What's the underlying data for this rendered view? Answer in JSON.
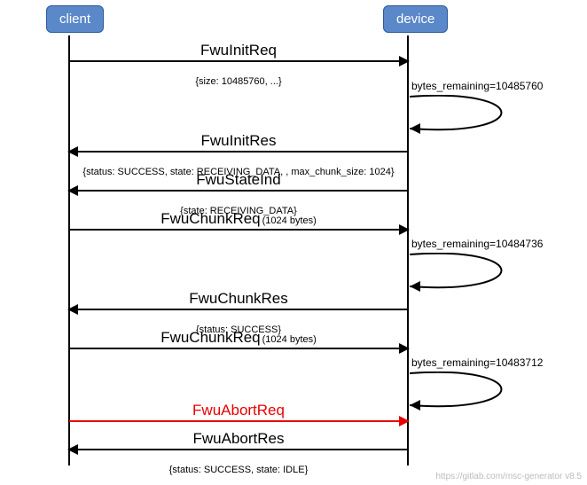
{
  "participants": {
    "client": "client",
    "device": "device"
  },
  "messages": {
    "m1": {
      "title": "FwuInitReq",
      "sub": "{size: 10485760, ...}"
    },
    "m2": {
      "title": "FwuInitRes",
      "sub": "{status: SUCCESS, state: RECEIVING_DATA, , max_chunk_size: 1024}"
    },
    "m3": {
      "title": "FwuStateInd",
      "sub": "{state: RECEIVING_DATA}"
    },
    "m4": {
      "title": "FwuChunkReq",
      "titleSuffix": "(1024 bytes)"
    },
    "m5": {
      "title": "FwuChunkRes",
      "sub": "{status: SUCCESS}"
    },
    "m6": {
      "title": "FwuChunkReq",
      "titleSuffix": "(1024 bytes)"
    },
    "m7": {
      "title": "FwuAbortReq"
    },
    "m8": {
      "title": "FwuAbortRes",
      "sub": "{status: SUCCESS, state: IDLE}"
    }
  },
  "selfMessages": {
    "s1": "bytes_remaining=10485760",
    "s2": "bytes_remaining=10484736",
    "s3": "bytes_remaining=10483712"
  },
  "credit": "https://gitlab.com/msc-generator v8.5",
  "chart_data": {
    "type": "sequence-diagram",
    "participants": [
      "client",
      "device"
    ],
    "events": [
      {
        "from": "client",
        "to": "device",
        "label": "FwuInitReq",
        "params": "{size: 10485760, ...}"
      },
      {
        "from": "device",
        "to": "device",
        "label": "bytes_remaining=10485760"
      },
      {
        "from": "device",
        "to": "client",
        "label": "FwuInitRes",
        "params": "{status: SUCCESS, state: RECEIVING_DATA, , max_chunk_size: 1024}"
      },
      {
        "from": "device",
        "to": "client",
        "label": "FwuStateInd",
        "params": "{state: RECEIVING_DATA}"
      },
      {
        "from": "client",
        "to": "device",
        "label": "FwuChunkReq",
        "params": "(1024 bytes)"
      },
      {
        "from": "device",
        "to": "device",
        "label": "bytes_remaining=10484736"
      },
      {
        "from": "device",
        "to": "client",
        "label": "FwuChunkRes",
        "params": "{status: SUCCESS}"
      },
      {
        "from": "client",
        "to": "device",
        "label": "FwuChunkReq",
        "params": "(1024 bytes)"
      },
      {
        "from": "device",
        "to": "device",
        "label": "bytes_remaining=10483712"
      },
      {
        "from": "client",
        "to": "device",
        "label": "FwuAbortReq",
        "color": "red"
      },
      {
        "from": "device",
        "to": "client",
        "label": "FwuAbortRes",
        "params": "{status: SUCCESS, state: IDLE}"
      }
    ]
  }
}
